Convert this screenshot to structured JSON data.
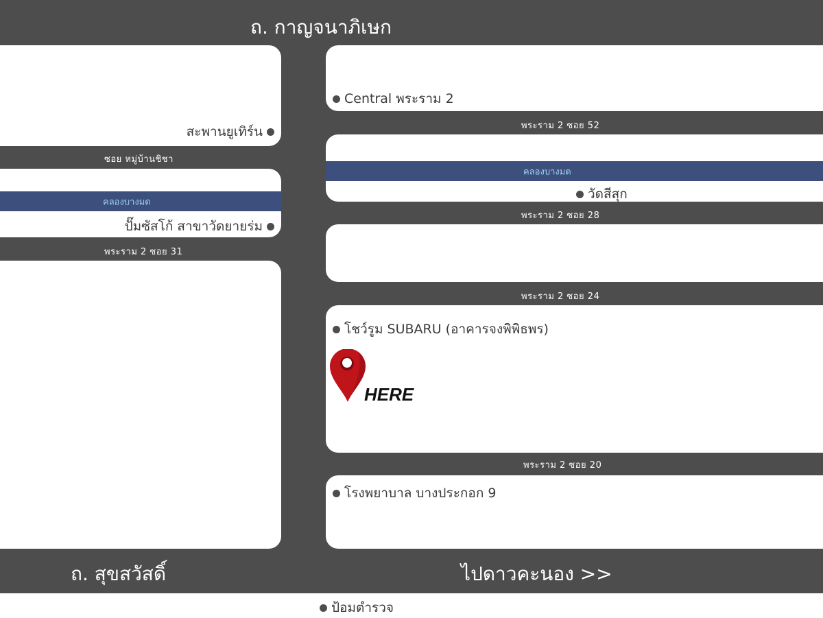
{
  "roads": {
    "top": "ถ. กาญจนาภิเษก",
    "bottom_left": "ถ. สุขสวัสดิ์",
    "bottom_right": "ไปดาวคะนอง >>",
    "soi_52": "พระราม 2 ซอย 52",
    "soi_mubansicha": "ซอย หมู่บ้านชิชา",
    "soi_28": "พระราม 2 ซอย 28",
    "soi_31": "พระราม 2 ซอย 31",
    "soi_24": "พระราม 2 ซอย 24",
    "soi_20": "พระราม 2 ซอย 20"
  },
  "canals": {
    "left": "คลองบางมด",
    "right": "คลองบางมด"
  },
  "places": {
    "central": "Central พระราม 2",
    "saphan": "สะพานยูเทิร์น",
    "wat_sisuk": "วัดสีสุก",
    "pump": "ปั๊มซัสโก้ สาขาวัดยายร่ม",
    "showroom": "โชว์รูม SUBARU (อาคารจงพิพิธพร)",
    "hospital": "โรงพยาบาล บางประกอก 9",
    "police": "ป้อมตำรวจ"
  },
  "marker": {
    "label": "HERE",
    "icon": "map-pin-icon"
  },
  "colors": {
    "road": "#4d4d4d",
    "block": "#ffffff",
    "canal": "#3d4f7d",
    "canal_text": "#9fd0f2",
    "pin": "#c0141b"
  }
}
